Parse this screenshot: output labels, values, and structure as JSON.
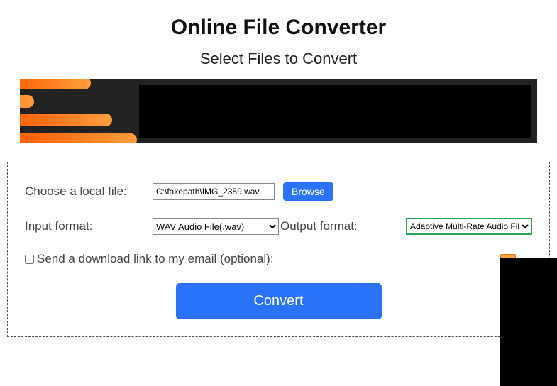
{
  "title": "Online File Converter",
  "subtitle": "Select Files to Convert",
  "form": {
    "choose_label": "Choose a local file:",
    "file_value": "C:\\fakepath\\IMG_2359.wav",
    "browse_label": "Browse",
    "input_format_label": "Input format:",
    "input_format_value": "WAV Audio File(.wav)",
    "output_format_label": "Output format:",
    "output_format_value": "Adaptive Multi-Rate Audio File(.amr)",
    "email_label": "Send a download link to my email (optional):",
    "convert_label": "Convert"
  }
}
